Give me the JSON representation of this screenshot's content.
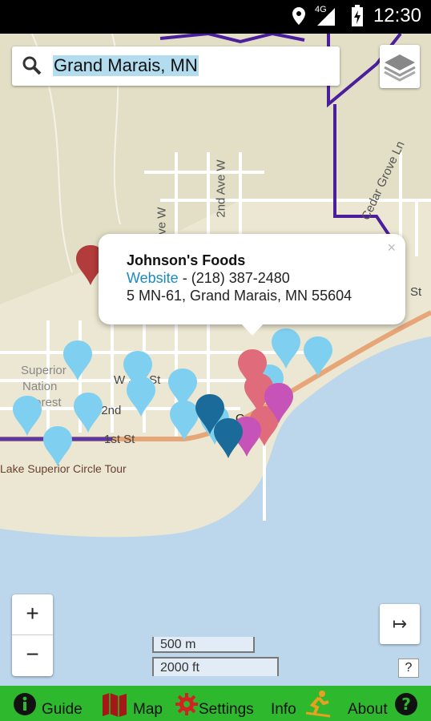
{
  "status_bar": {
    "time": "12:30",
    "network": "4G"
  },
  "search": {
    "query": "Grand Marais, MN"
  },
  "popup": {
    "name": "Johnson's Foods",
    "website_label": "Website",
    "phone": "- (218) 387-2480",
    "address": "5 MN-61, Grand Marais, MN 55604",
    "close": "×"
  },
  "map_labels": {
    "ave_w": "Ave W",
    "second_ave_w": "2nd Ave W",
    "cedar_grove": "Cedar Grove Ln",
    "w3rd": "W 3rd St",
    "w2nd": "W 2nd",
    "first_st": "1st St",
    "superior": "Superior",
    "national": "Nation",
    "forest": "Forest",
    "circle_tour": "Lake Superior Circle Tour",
    "st_right": "St",
    "g_label": "G"
  },
  "zoom": {
    "in": "+",
    "out": "−"
  },
  "scale": {
    "metric": "500 m",
    "imperial": "2000 ft"
  },
  "controls": {
    "arrow": "↦",
    "help": "?"
  },
  "nav": [
    {
      "label": "Guide",
      "icon": "info-icon"
    },
    {
      "label": "Map",
      "icon": "map-icon"
    },
    {
      "label": "Settings",
      "icon": "gear-icon"
    },
    {
      "label": "Info",
      "icon": "skier-icon"
    },
    {
      "label": "About",
      "icon": "help-icon"
    }
  ],
  "colors": {
    "nav_bg": "#2eb82e",
    "water": "#bcd6ec",
    "lodging_pin": "#7fd0f0",
    "service_pin": "#1b6b9a",
    "food_pin": "#e06b7a",
    "mail_pin": "#c553b8",
    "medical_pin": "#b23b3b"
  }
}
